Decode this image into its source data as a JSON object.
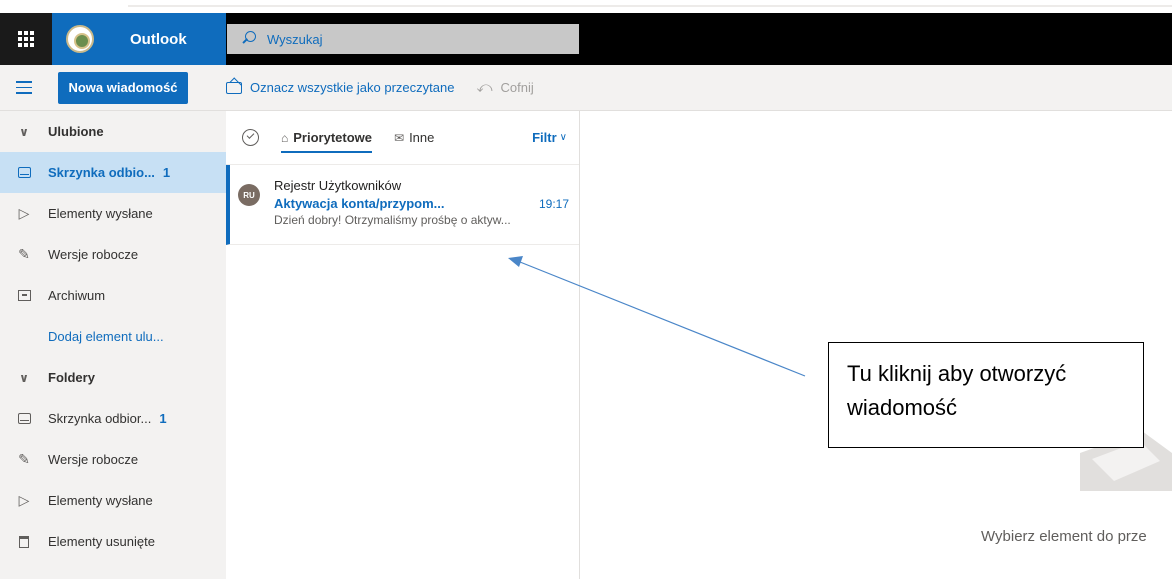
{
  "header": {
    "app_name": "Outlook",
    "search_placeholder": "Wyszukaj",
    "brand_color": "#0f6cbd"
  },
  "toolbar": {
    "new_message": "Nowa wiadomość",
    "mark_all_read": "Oznacz wszystkie jako przeczytane",
    "undo": "Cofnij"
  },
  "sidebar": {
    "favorites_section": "Ulubione",
    "favorites": [
      {
        "label": "Skrzynka odbio...",
        "count": "1",
        "icon": "inbox-icon",
        "active": true
      },
      {
        "label": "Elementy wysłane",
        "icon": "send-icon"
      },
      {
        "label": "Wersje robocze",
        "icon": "pencil-icon"
      },
      {
        "label": "Archiwum",
        "icon": "archive-icon"
      }
    ],
    "add_favorite": "Dodaj element ulu...",
    "folders_section": "Foldery",
    "folders": [
      {
        "label": "Skrzynka odbior...",
        "count": "1",
        "icon": "inbox-icon"
      },
      {
        "label": "Wersje robocze",
        "icon": "pencil-icon"
      },
      {
        "label": "Elementy wysłane",
        "icon": "send-icon"
      },
      {
        "label": "Elementy usunięte",
        "icon": "trash-icon"
      }
    ]
  },
  "list": {
    "tabs": [
      {
        "label": "Priorytetowe",
        "active": true
      },
      {
        "label": "Inne",
        "active": false
      }
    ],
    "filter": "Filtr",
    "messages": [
      {
        "avatar": "RU",
        "sender": "Rejestr Użytkowników",
        "subject": "Aktywacja konta/przypom...",
        "time": "19:17",
        "preview": "Dzień dobry! Otrzymaliśmy prośbę o aktyw..."
      }
    ]
  },
  "reading_pane": {
    "empty_text": "Wybierz element do prze"
  },
  "annotation": {
    "callout_line1": "Tu kliknij aby otworzyć",
    "callout_line2": "wiadomość"
  }
}
